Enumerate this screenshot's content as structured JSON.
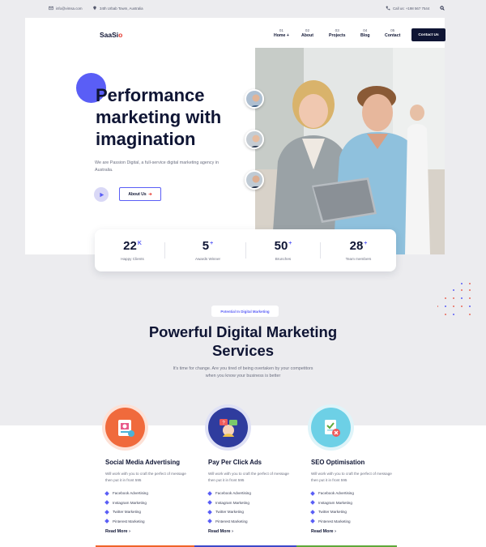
{
  "topbar": {
    "email": "info@vimsa.com",
    "address": "34th Urbab Towm, Australia",
    "phone": "Call us: +198 567 7544"
  },
  "header": {
    "logo_main": "SaaSi",
    "logo_accent": "o",
    "nav": [
      {
        "num": "01",
        "label": "Home +"
      },
      {
        "num": "02",
        "label": "About"
      },
      {
        "num": "03",
        "label": "Projects"
      },
      {
        "num": "04",
        "label": "Blog"
      },
      {
        "num": "05",
        "label": "Contact"
      }
    ],
    "cta": "Contact Us"
  },
  "hero": {
    "title_l1": "Performance",
    "title_l2": "marketing with",
    "title_l3": "imagination",
    "description": "We are Passion Digital, a full-service digital marketing agency in Australia.",
    "about_button": "About Us"
  },
  "stats": [
    {
      "value": "22",
      "suffix": "K",
      "label": "Happy Clients"
    },
    {
      "value": "5",
      "suffix": "+",
      "label": "Awards Winner"
    },
    {
      "value": "50",
      "suffix": "+",
      "label": "Brunches"
    },
    {
      "value": "28",
      "suffix": "+",
      "label": "Team members"
    }
  ],
  "services_section": {
    "badge": "Potential In Digital Marketing",
    "title_l1": "Powerful Digital Marketing",
    "title_l2": "Services",
    "description": "It's time for change. Are you tired of being overtaken by your competitors when you know your business is better"
  },
  "services": [
    {
      "title": "Social Media Advertising",
      "description": "Will work with you to craft the perfect of message then put it in front 595",
      "items": [
        "Facebook Advertising",
        "Instagram Marketing",
        "Twitter Marketing",
        "Pinterest Marketing"
      ],
      "read_more": "Read More"
    },
    {
      "title": "Pay Per Click Ads",
      "description": "Will work with you to craft the perfect of message then put it in front 595",
      "items": [
        "Facebook Advertising",
        "Instagram Marketing",
        "Twitter Marketing",
        "Pinterest Marketing"
      ],
      "read_more": "Read More"
    },
    {
      "title": "SEO Optimisation",
      "description": "Will work with you to craft the perfect of message then put it in front 595",
      "items": [
        "Facebook Advertising",
        "Instagram Marketing",
        "Twitter Marketing",
        "Pinterest Marketing"
      ],
      "read_more": "Read More"
    }
  ],
  "colors": {
    "accent": "#5a5ef6",
    "navy": "#0f1534",
    "red": "#e5352b",
    "bar_orange": "#f0642a",
    "bar_blue": "#3d49c9",
    "bar_green": "#5fa83a"
  }
}
